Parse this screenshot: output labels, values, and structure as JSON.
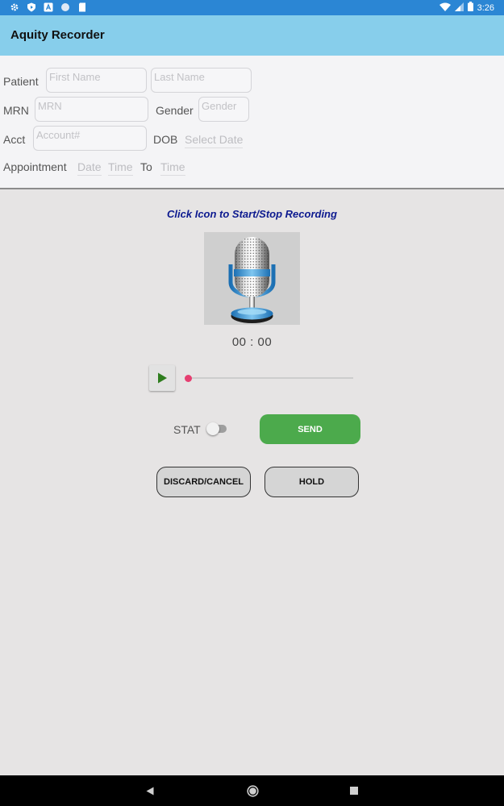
{
  "status_bar": {
    "time": "3:26",
    "left_icons": [
      "settings-icon",
      "shield-play-icon",
      "font-a-icon",
      "circle-icon",
      "sd-card-icon"
    ],
    "right_icons": [
      "wifi-icon",
      "signal-icon",
      "battery-icon"
    ]
  },
  "app_bar": {
    "title": "Aquity Recorder"
  },
  "form": {
    "patient_label": "Patient",
    "first_name_placeholder": "First Name",
    "last_name_placeholder": "Last Name",
    "mrn_label": "MRN",
    "mrn_placeholder": "MRN",
    "gender_label": "Gender",
    "gender_placeholder": "Gender",
    "acct_label": "Acct",
    "acct_placeholder": "Account#",
    "dob_label": "DOB",
    "dob_value": "Select Date",
    "appointment_label": "Appointment",
    "date_value": "Date",
    "start_time_value": "Time",
    "to_label": "To",
    "end_time_value": "Time"
  },
  "recorder": {
    "hint": "Click Icon to Start/Stop Recording",
    "timer": "00 : 00",
    "progress": 0
  },
  "actions": {
    "stat_label": "STAT",
    "stat_enabled": false,
    "send_label": "SEND",
    "discard_label": "DISCARD/CANCEL",
    "hold_label": "HOLD"
  },
  "colors": {
    "status_bar": "#2b86d4",
    "app_bar": "#87ceeb",
    "hint_text": "#0d1a8f",
    "send_button": "#4caa4c",
    "seek_thumb": "#e63f71",
    "background": "#e6e4e4"
  }
}
